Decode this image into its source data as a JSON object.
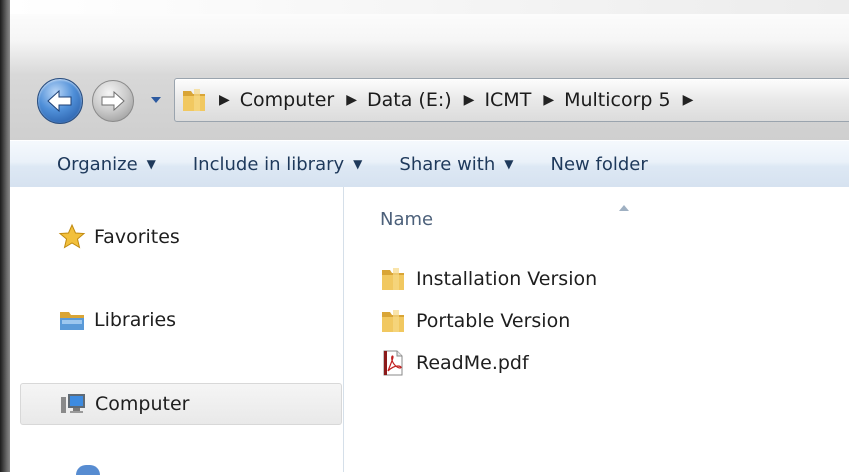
{
  "breadcrumb": [
    "Computer",
    "Data (E:)",
    "ICMT",
    "Multicorp 5"
  ],
  "toolbar": {
    "organize": "Organize",
    "include_in_library": "Include in library",
    "share_with": "Share with",
    "new_folder": "New folder"
  },
  "nav_pane": {
    "favorites": "Favorites",
    "libraries": "Libraries",
    "computer": "Computer"
  },
  "file_list": {
    "column_name": "Name",
    "items": [
      {
        "name": "Installation Version",
        "icon": "folder-icon"
      },
      {
        "name": "Portable Version",
        "icon": "folder-icon"
      },
      {
        "name": "ReadMe.pdf",
        "icon": "pdf-file-icon"
      }
    ]
  },
  "colors": {
    "toolbar_text": "#1e395b",
    "folder": "#e8b84a",
    "back_button": "#4f8fd8"
  }
}
